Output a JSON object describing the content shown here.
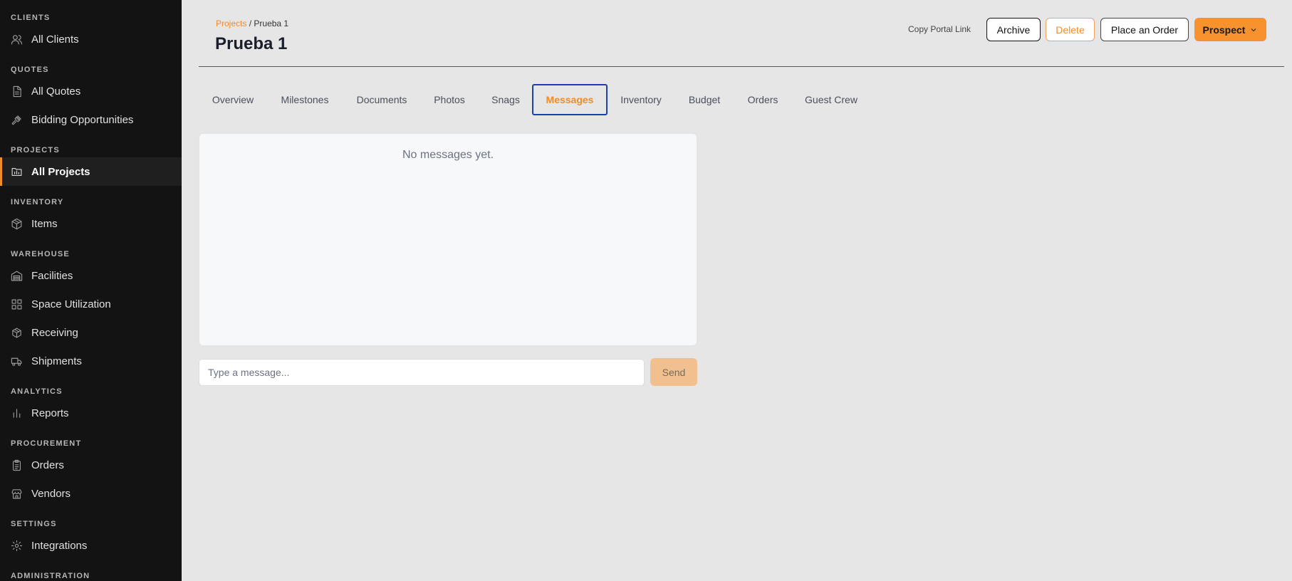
{
  "sidebar": {
    "sections": [
      {
        "title": "CLIENTS",
        "items": [
          {
            "label": "All Clients",
            "icon": "users-icon"
          }
        ]
      },
      {
        "title": "QUOTES",
        "items": [
          {
            "label": "All Quotes",
            "icon": "document-icon"
          },
          {
            "label": "Bidding Opportunities",
            "icon": "gavel-icon"
          }
        ]
      },
      {
        "title": "PROJECTS",
        "items": [
          {
            "label": "All Projects",
            "icon": "folder-chart-icon",
            "active": true
          }
        ]
      },
      {
        "title": "INVENTORY",
        "items": [
          {
            "label": "Items",
            "icon": "box-icon"
          }
        ]
      },
      {
        "title": "WAREHOUSE",
        "items": [
          {
            "label": "Facilities",
            "icon": "warehouse-icon"
          },
          {
            "label": "Space Utilization",
            "icon": "grid-icon"
          },
          {
            "label": "Receiving",
            "icon": "package-receive-icon"
          },
          {
            "label": "Shipments",
            "icon": "truck-icon"
          }
        ]
      },
      {
        "title": "ANALYTICS",
        "items": [
          {
            "label": "Reports",
            "icon": "bar-chart-icon"
          }
        ]
      },
      {
        "title": "PROCUREMENT",
        "items": [
          {
            "label": "Orders",
            "icon": "clipboard-icon"
          },
          {
            "label": "Vendors",
            "icon": "store-icon"
          }
        ]
      },
      {
        "title": "SETTINGS",
        "items": [
          {
            "label": "Integrations",
            "icon": "gear-icon"
          }
        ]
      },
      {
        "title": "ADMINISTRATION",
        "items": []
      }
    ]
  },
  "header": {
    "breadcrumb_link": "Projects",
    "breadcrumb_separator": "/",
    "breadcrumb_current": "Prueba 1",
    "title": "Prueba 1",
    "copy_portal_link": "Copy Portal Link",
    "archive_label": "Archive",
    "delete_label": "Delete",
    "place_order_label": "Place an Order",
    "status_label": "Prospect"
  },
  "tabs": [
    {
      "label": "Overview"
    },
    {
      "label": "Milestones"
    },
    {
      "label": "Documents"
    },
    {
      "label": "Photos"
    },
    {
      "label": "Snags"
    },
    {
      "label": "Messages",
      "active": true
    },
    {
      "label": "Inventory"
    },
    {
      "label": "Budget"
    },
    {
      "label": "Orders"
    },
    {
      "label": "Guest Crew"
    }
  ],
  "messages": {
    "empty_text": "No messages yet.",
    "input_placeholder": "Type a message...",
    "input_value": "",
    "send_label": "Send"
  },
  "colors": {
    "accent": "#f28c28",
    "sidebar_bg": "#131313",
    "page_bg": "#e6e6e6",
    "active_tab_border": "#1e40af"
  }
}
